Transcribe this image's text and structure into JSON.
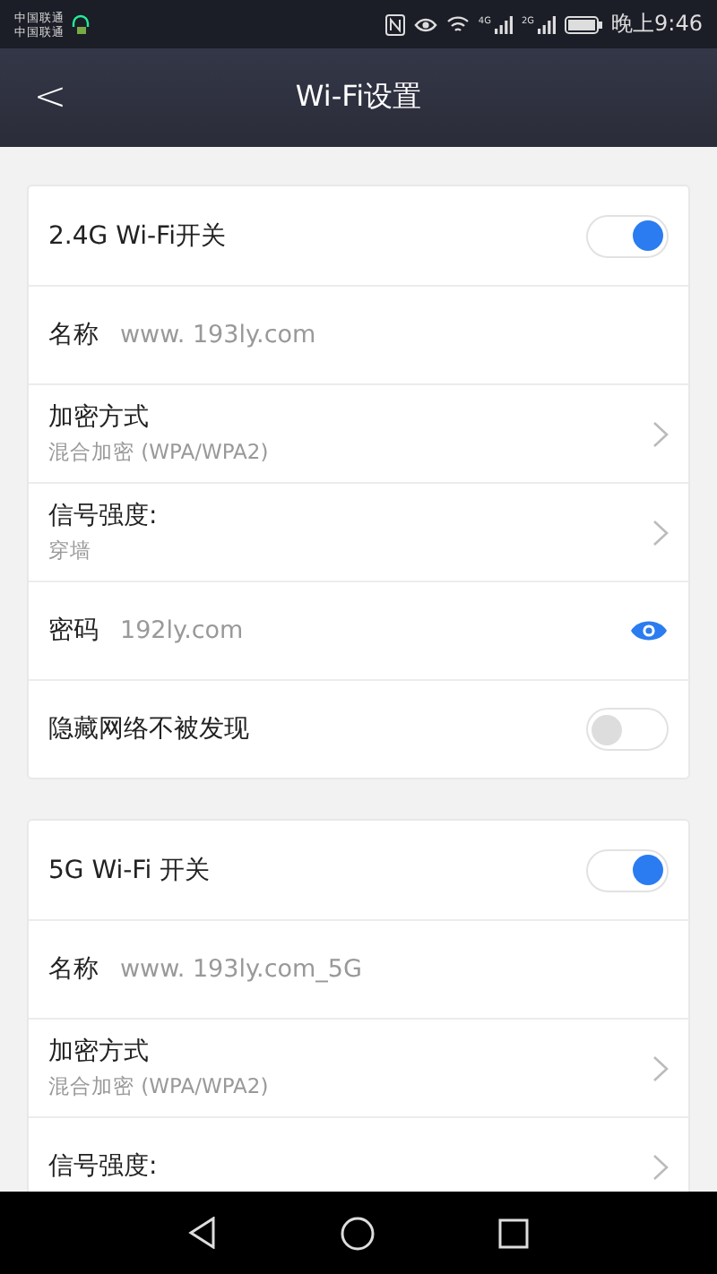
{
  "status_bar": {
    "carriers": [
      "中国联通",
      "中国联通"
    ],
    "network_labels": [
      "4G",
      "2G"
    ],
    "time": "晚上9:46"
  },
  "header": {
    "back": "<",
    "title": "Wi-Fi设置"
  },
  "sections": [
    {
      "rows": [
        {
          "kind": "toggle",
          "label": "2.4G Wi-Fi开关",
          "on": true
        },
        {
          "kind": "field",
          "label": "名称",
          "value": "www. 193ly.com"
        },
        {
          "kind": "select",
          "label": "加密方式",
          "sub": "混合加密 (WPA/WPA2)"
        },
        {
          "kind": "select",
          "label": "信号强度:",
          "sub": "穿墙"
        },
        {
          "kind": "password",
          "label": "密码",
          "value": "192ly.com",
          "visible": true
        },
        {
          "kind": "toggle",
          "label": "隐藏网络不被发现",
          "on": false
        }
      ]
    },
    {
      "rows": [
        {
          "kind": "toggle",
          "label": "5G Wi-Fi 开关",
          "on": true
        },
        {
          "kind": "field",
          "label": "名称",
          "value": "www. 193ly.com_5G"
        },
        {
          "kind": "select",
          "label": "加密方式",
          "sub": "混合加密 (WPA/WPA2)"
        },
        {
          "kind": "select",
          "label": "信号强度:"
        }
      ]
    }
  ]
}
